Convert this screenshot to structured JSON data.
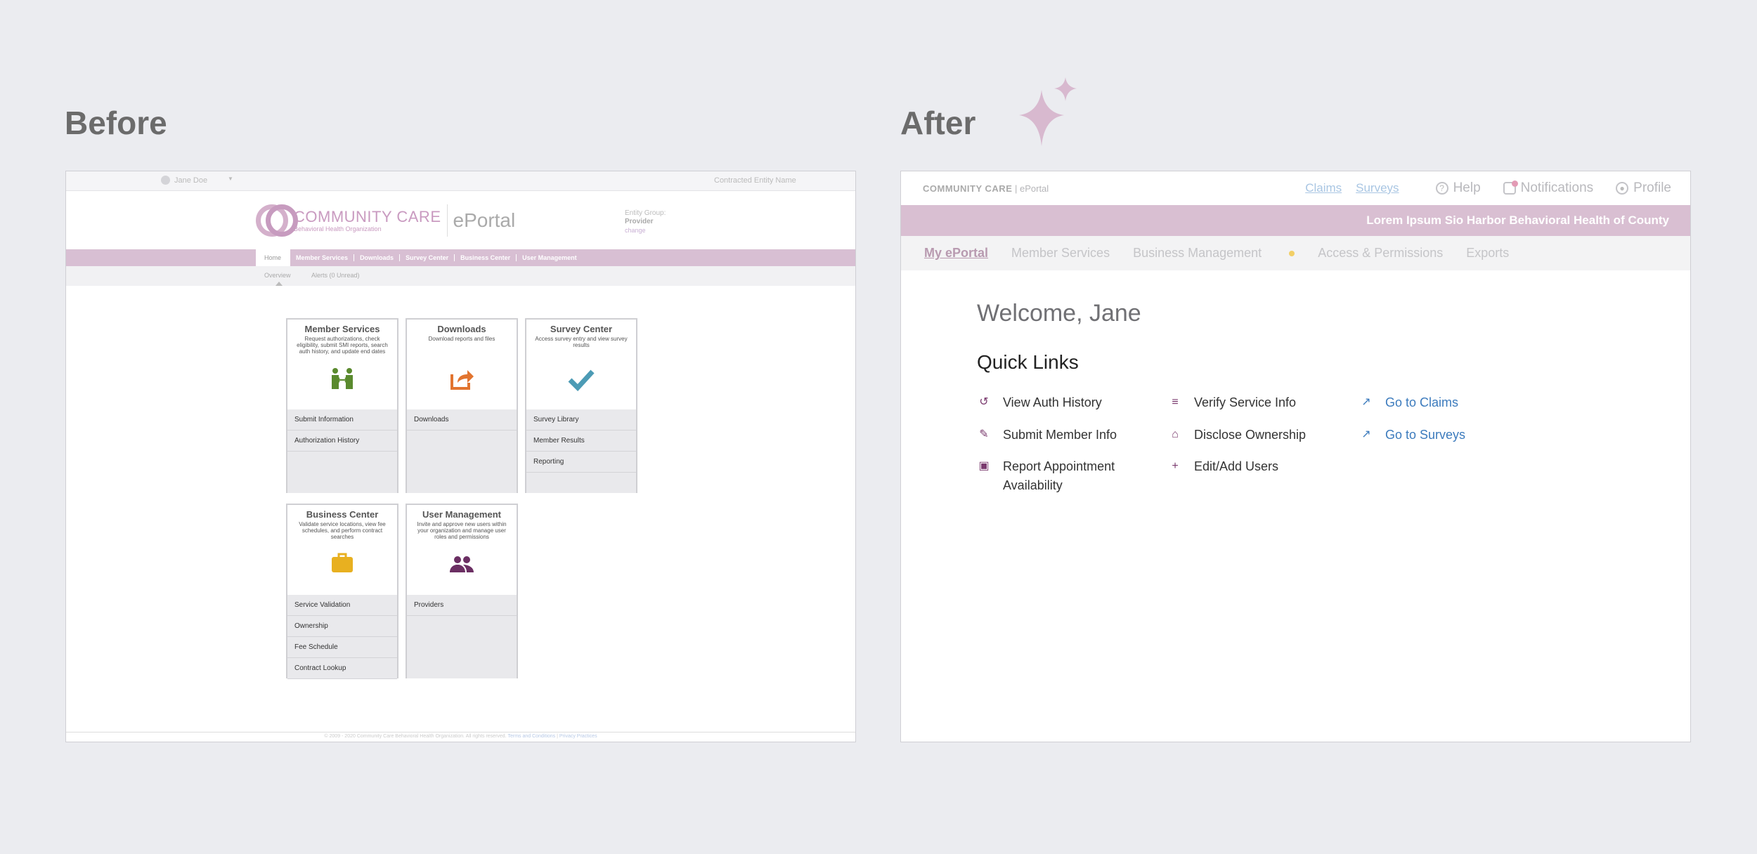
{
  "headings": {
    "before": "Before",
    "after": "After"
  },
  "before": {
    "user_name": "Jane Doe",
    "entity_name": "Contracted Entity Name",
    "brand_name": "COMMUNITY CARE",
    "brand_sub": "Behavioral Health Organization",
    "eportal": "ePortal",
    "entity_group": {
      "label": "Entity Group:",
      "value": "Provider",
      "change": "change"
    },
    "nav": [
      "Home",
      "Member Services",
      "Downloads",
      "Survey Center",
      "Business Center",
      "User Management"
    ],
    "subnav": [
      "Overview",
      "Alerts (0 Unread)"
    ],
    "cards": [
      {
        "title": "Member Services",
        "desc": "Request authorizations, check eligibility, submit SMI reports, search auth history, and update end dates",
        "icon": "handshake-icon",
        "icon_color": "#5a8a2e",
        "links": [
          "Submit Information",
          "Authorization History"
        ]
      },
      {
        "title": "Downloads",
        "desc": "Download reports and files",
        "icon": "share-icon",
        "icon_color": "#e2742f",
        "links": [
          "Downloads"
        ]
      },
      {
        "title": "Survey Center",
        "desc": "Access survey entry and view survey results",
        "icon": "checkmark-icon",
        "icon_color": "#4c9bb5",
        "links": [
          "Survey Library",
          "Member Results",
          "Reporting"
        ]
      },
      {
        "title": "Business Center",
        "desc": "Validate service locations, view fee schedules, and perform contract searches",
        "icon": "briefcase-icon",
        "icon_color": "#e8b020",
        "links": [
          "Service Validation",
          "Ownership",
          "Fee Schedule",
          "Contract Lookup"
        ]
      },
      {
        "title": "User Management",
        "desc": "Invite and approve new users within your organization and manage user roles and permissions",
        "icon": "users-icon",
        "icon_color": "#6b2f63",
        "links": [
          "Providers"
        ]
      }
    ],
    "footer": {
      "copyright": "© 2009 - 2020 Community Care Behavioral Health Organization. All rights reserved.",
      "terms": "Terms and Conditions",
      "privacy": "Privacy Practices"
    }
  },
  "after": {
    "logo": {
      "brand": "COMMUNITY CARE",
      "product": "ePortal"
    },
    "top_links": {
      "claims": "Claims",
      "surveys": "Surveys",
      "help": "Help",
      "notifications": "Notifications",
      "profile": "Profile"
    },
    "band_text": "Lorem Ipsum Sio Harbor Behavioral Health of County",
    "nav": [
      "My ePortal",
      "Member Services",
      "Business Management",
      "Access & Permissions",
      "Exports"
    ],
    "welcome": "Welcome, Jane",
    "quick_links_title": "Quick Links",
    "quick_links": [
      {
        "label": "View Auth History",
        "icon": "history-icon"
      },
      {
        "label": "Submit Member Info",
        "icon": "edit-icon"
      },
      {
        "label": "Report Appointment Availability",
        "icon": "calendar-icon"
      },
      {
        "label": "Verify Service Info",
        "icon": "checklist-icon"
      },
      {
        "label": "Disclose Ownership",
        "icon": "bank-icon"
      },
      {
        "label": "Edit/Add Users",
        "icon": "add-user-icon"
      },
      {
        "label": "Go to Claims",
        "icon": "external-link-icon"
      },
      {
        "label": "Go to Surveys",
        "icon": "external-link-icon"
      }
    ]
  }
}
